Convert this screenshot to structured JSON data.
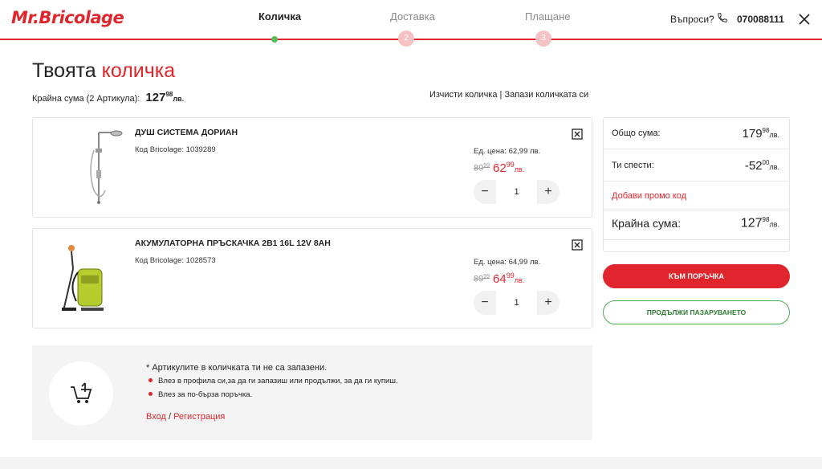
{
  "header": {
    "logo": "Mr.Bricolage",
    "steps": [
      {
        "label": "Количка",
        "state": "active"
      },
      {
        "label": "Доставка",
        "number": "2",
        "state": "inactive"
      },
      {
        "label": "Плащане",
        "number": "3",
        "state": "inactive"
      }
    ],
    "questions_label": "Въпроси?",
    "phone": "070088111"
  },
  "page": {
    "title_prefix": "Твоята",
    "title_accent": "количка",
    "total_label": "Крайна сума (2 Артикула):",
    "total_int": "127",
    "total_dec": "98",
    "currency": "лв.",
    "clear_cart": "Изчисти количка",
    "separator": "|",
    "save_cart": "Запази количката си"
  },
  "items": [
    {
      "name": "ДУШ СИСТЕМА ДОРИАН",
      "code": "Код Bricolage: 1039289",
      "unit_price": "Ед. цена: 62,99  лв.",
      "old_int": "89",
      "old_dec": "99",
      "new_int": "62",
      "new_dec": "99",
      "currency": "лв.",
      "qty": "1",
      "image": "shower-system"
    },
    {
      "name": "АКУМУЛАТОРНА ПРЪСКАЧКА 2В1 16L 12V 8AH",
      "code": "Код Bricolage: 1028573",
      "unit_price": "Ед. цена: 64,99  лв.",
      "old_int": "89",
      "old_dec": "99",
      "new_int": "64",
      "new_dec": "99",
      "currency": "лв.",
      "qty": "1",
      "image": "sprayer"
    }
  ],
  "qty_controls": {
    "minus": "−",
    "plus": "+"
  },
  "summary": {
    "subtotal_label": "Общо сума:",
    "subtotal_int": "179",
    "subtotal_dec": "98",
    "savings_label": "Ти спести:",
    "savings_int": "-52",
    "savings_dec": "00",
    "promo_label": "Добави промо код",
    "final_label": "Крайна сума:",
    "final_int": "127",
    "final_dec": "98",
    "currency": "лв."
  },
  "actions": {
    "order": "КЪМ ПОРЪЧКА",
    "continue": "ПРОДЪЛЖИ ПАЗАРУВАНЕТО"
  },
  "info": {
    "title": "* Артикулите в количката ти не са запазени.",
    "bullets": [
      "Влез в профила си,за да ги запазиш или продължи, за да ги купиш.",
      "Влез за по-бърза поръчка."
    ],
    "login": "Вход",
    "slash": "/",
    "register": "Регистрация"
  },
  "colors": {
    "accent": "#e0262c",
    "green": "#4caf50",
    "step_inactive": "#f4c2c4"
  }
}
